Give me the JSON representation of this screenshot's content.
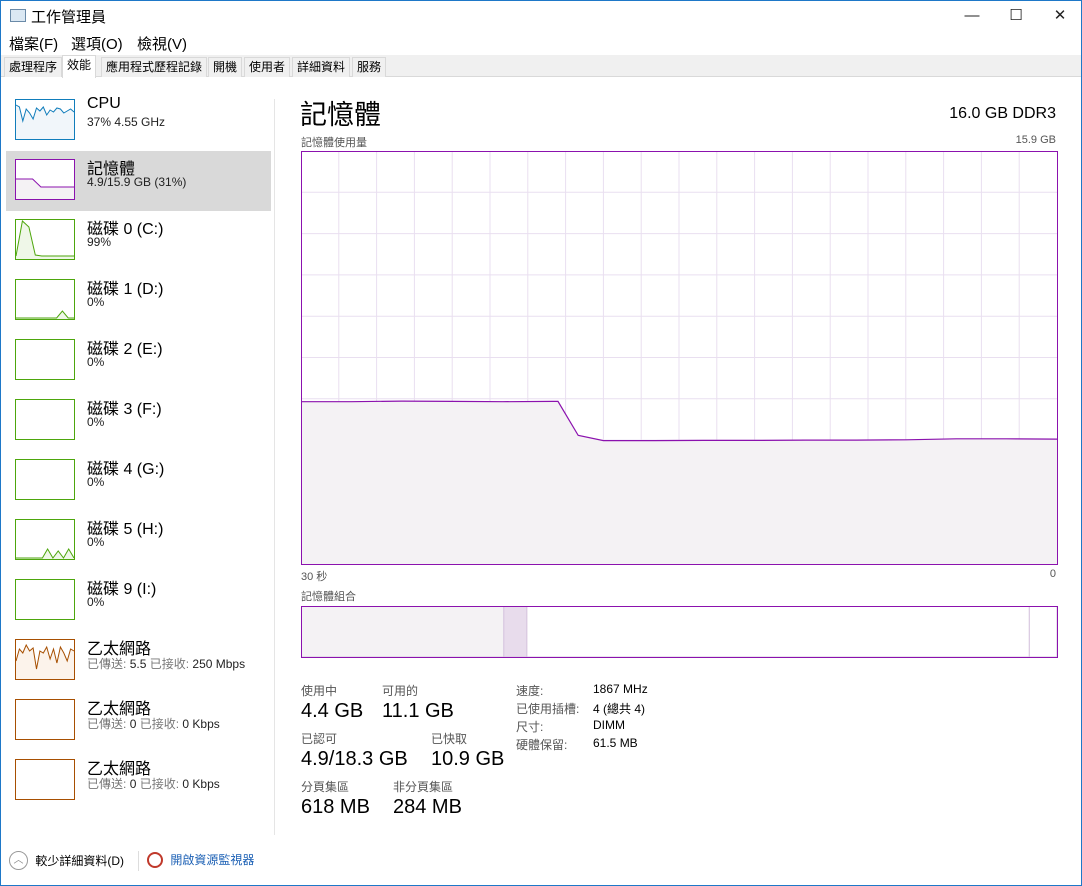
{
  "window": {
    "title": "工作管理員",
    "minimize": "—",
    "maximize": "☐",
    "close": "✕"
  },
  "menu": [
    "檔案(F)",
    "選項(O)",
    "檢視(V)"
  ],
  "tabs": [
    "處理程序",
    "效能",
    "應用程式歷程記錄",
    "開機",
    "使用者",
    "詳細資料",
    "服務"
  ],
  "sidebar": [
    {
      "name": "CPU",
      "sub": "37% 4.55 GHz",
      "color": "#117dbb",
      "fill": "#f1f6fa"
    },
    {
      "name": "記憶體",
      "sub": "4.9/15.9 GB (31%)",
      "color": "#8b12ae",
      "fill": "#f4f2f4"
    },
    {
      "name": "磁碟 0 (C:)",
      "sub": "99%",
      "color": "#4da60c",
      "fill": "#eff7e8"
    },
    {
      "name": "磁碟 1 (D:)",
      "sub": "0%",
      "color": "#4da60c",
      "fill": "#eff7e8"
    },
    {
      "name": "磁碟 2 (E:)",
      "sub": "0%",
      "color": "#4da60c",
      "fill": "#eff7e8"
    },
    {
      "name": "磁碟 3 (F:)",
      "sub": "0%",
      "color": "#4da60c",
      "fill": "#eff7e8"
    },
    {
      "name": "磁碟 4 (G:)",
      "sub": "0%",
      "color": "#4da60c",
      "fill": "#eff7e8"
    },
    {
      "name": "磁碟 5 (H:)",
      "sub": "0%",
      "color": "#4da60c",
      "fill": "#eff7e8"
    },
    {
      "name": "磁碟 9 (I:)",
      "sub": "0%",
      "color": "#4da60c",
      "fill": "#eff7e8"
    },
    {
      "name": "乙太網路",
      "sent_label": "已傳送:",
      "sent": "5.5",
      "recv_label": "已接收:",
      "recv": "250 Mbps",
      "color": "#a74f01",
      "fill": "#fcf3eb"
    },
    {
      "name": "乙太網路",
      "sent_label": "已傳送:",
      "sent": "0",
      "recv_label": "已接收:",
      "recv": "0 Kbps",
      "color": "#a74f01",
      "fill": "#fcf3eb"
    },
    {
      "name": "乙太網路",
      "sent_label": "已傳送:",
      "sent": "0",
      "recv_label": "已接收:",
      "recv": "0 Kbps",
      "color": "#a74f01",
      "fill": "#fcf3eb"
    }
  ],
  "main": {
    "title": "記憶體",
    "spec": "16.0 GB DDR3",
    "usage_label": "記憶體使用量",
    "max_label": "15.9 GB",
    "time_left": "30 秒",
    "time_right": "0",
    "composition_label": "記憶體組合"
  },
  "chart_data": {
    "type": "area",
    "title": "記憶體使用量",
    "ylim": [
      0,
      15.9
    ],
    "xlim": [
      30,
      0
    ],
    "unit": "GB",
    "color": "#8b12ae",
    "x": [
      30,
      28,
      26,
      24,
      22,
      20,
      19.8,
      19,
      18,
      16,
      14,
      12,
      10,
      8,
      6,
      4,
      2,
      0
    ],
    "values": [
      6.25,
      6.25,
      6.27,
      6.26,
      6.25,
      6.26,
      6.26,
      4.95,
      4.75,
      4.75,
      4.76,
      4.76,
      4.77,
      4.77,
      4.78,
      4.82,
      4.82,
      4.81
    ]
  },
  "composition": {
    "in_use": 4.4,
    "modified": 0.5,
    "standby": 10.9,
    "free": 0.6,
    "total": 16.4
  },
  "stats": {
    "in_use_label": "使用中",
    "in_use": "4.4 GB",
    "available_label": "可用的",
    "available": "11.1 GB",
    "committed_label": "已認可",
    "committed": "4.9/18.3 GB",
    "cached_label": "已快取",
    "cached": "10.9 GB",
    "paged_label": "分頁集區",
    "paged": "618 MB",
    "nonpaged_label": "非分頁集區",
    "nonpaged": "284 MB"
  },
  "specs": [
    {
      "k": "速度:",
      "v": "1867 MHz"
    },
    {
      "k": "已使用插槽:",
      "v": "4 (總共 4)"
    },
    {
      "k": "尺寸:",
      "v": "DIMM"
    },
    {
      "k": "硬體保留:",
      "v": "61.5 MB"
    }
  ],
  "footer": {
    "fewer": "較少詳細資料(D)",
    "monitor": "開啟資源監視器"
  }
}
